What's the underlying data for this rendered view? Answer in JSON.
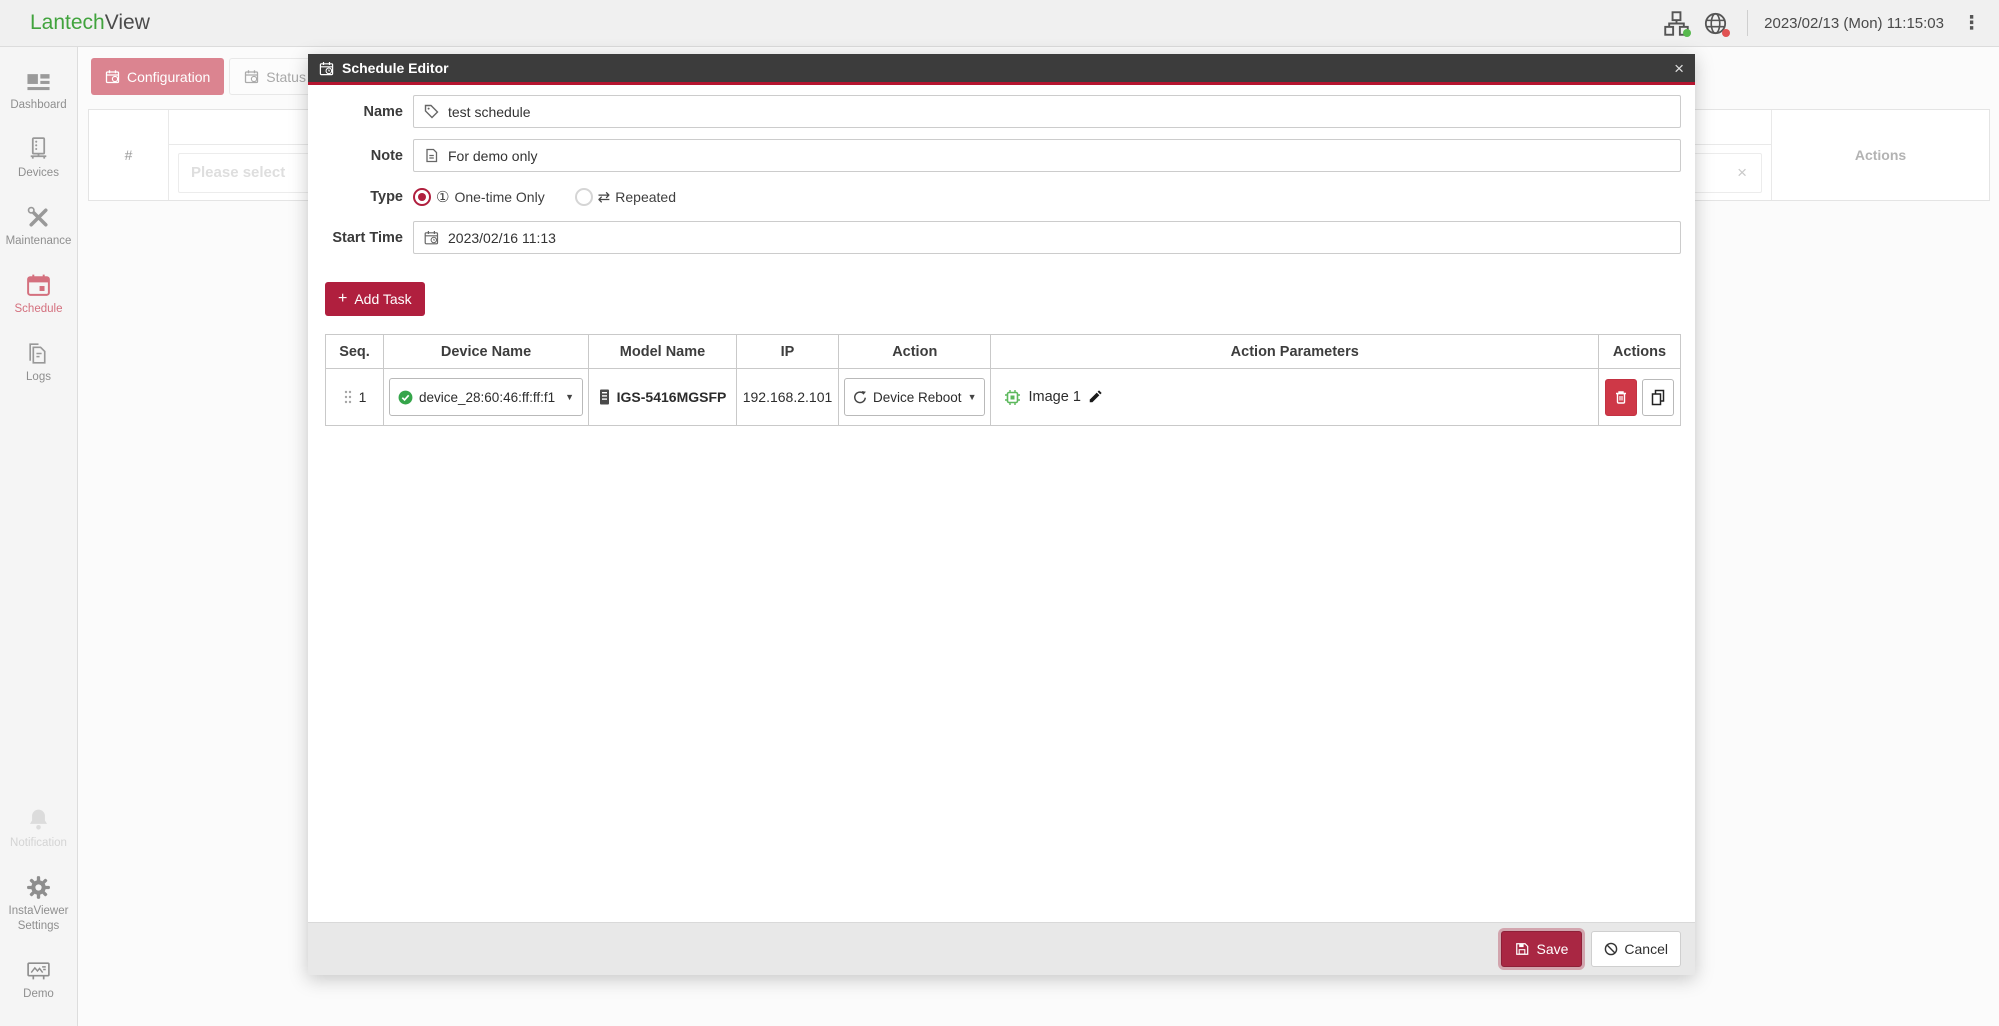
{
  "topbar": {
    "brand_primary": "Lantech",
    "brand_secondary": "View",
    "datetime": "2023/02/13 (Mon) 11:15:03"
  },
  "sidebar": {
    "items_top": [
      {
        "label": "Dashboard"
      },
      {
        "label": "Devices"
      },
      {
        "label": "Maintenance"
      },
      {
        "label": "Schedule"
      },
      {
        "label": "Logs"
      }
    ],
    "items_bottom": [
      {
        "label": "Notification"
      },
      {
        "label": "InstaViewer Settings"
      },
      {
        "label": "Demo"
      }
    ]
  },
  "content_tabs": {
    "configuration_label": "Configuration",
    "status_label": "Status"
  },
  "background_table": {
    "index_header": "#",
    "filter_placeholder": "Please select",
    "actions_header": "Actions"
  },
  "modal": {
    "title": "Schedule Editor",
    "form": {
      "name_label": "Name",
      "name_value": "test schedule",
      "note_label": "Note",
      "note_value": "For demo only",
      "type_label": "Type",
      "type_onetime_label": "One-time Only",
      "type_repeated_label": "Repeated",
      "start_time_label": "Start Time",
      "start_time_value": "2023/02/16 11:13"
    },
    "add_task_label": "Add Task",
    "table": {
      "headers": [
        "Seq.",
        "Device Name",
        "Model Name",
        "IP",
        "Action",
        "Action Parameters",
        "Actions"
      ],
      "rows": [
        {
          "seq": "1",
          "device_name": "device_28:60:46:ff:ff:f1",
          "model_name": "IGS-5416MGSFP",
          "ip": "192.168.2.101",
          "action": "Device Reboot",
          "action_parameter": "Image 1"
        }
      ]
    },
    "footer": {
      "save_label": "Save",
      "cancel_label": "Cancel"
    }
  },
  "icons": {
    "kebab_menu": "⋮",
    "close": "×",
    "clear": "×",
    "caret_down": "▼",
    "circled_one": "①",
    "repeat_arrows": "⇄",
    "plus": "+"
  },
  "colors": {
    "accent_crimson": "#b01f3e",
    "header_red_line": "#b5152f",
    "brand_green": "#41a33d",
    "active_tab_pink": "#db8490",
    "sidebar_active_pink": "#d4707e",
    "status_green": "#58b94e",
    "status_red": "#e05252",
    "delete_red": "#ce3847",
    "chip_green": "#5cb85c"
  }
}
